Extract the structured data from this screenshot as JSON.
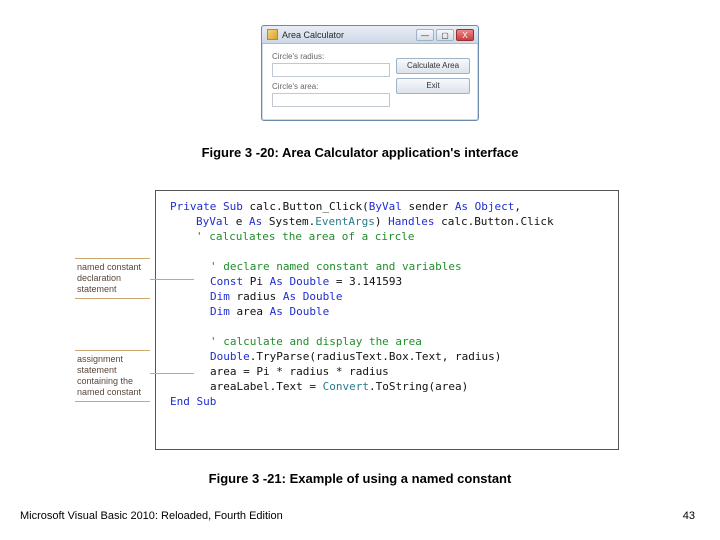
{
  "dialog": {
    "title": "Area Calculator",
    "label_radius": "Circle's radius:",
    "label_area": "Circle's area:",
    "btn_calc": "Calculate Area",
    "btn_exit": "Exit",
    "btn_min": "—",
    "btn_max": "▢",
    "btn_close": "X"
  },
  "caption1": "Figure 3 -20: Area Calculator application's interface",
  "caption2": "Figure 3 -21: Example of using a named constant",
  "anno1": "named constant declaration statement",
  "anno2": "assignment statement containing the named constant",
  "code": {
    "l1a": "Private Sub",
    "l1b": " calc.Button_Click(",
    "l1c": "ByVal",
    "l1d": " sender ",
    "l1e": "As Object",
    "l1f": ",",
    "l2a": "ByVal",
    "l2b": " e ",
    "l2c": "As",
    "l2d": " System.",
    "l2e": "EventArgs",
    "l2f": ") ",
    "l2g": "Handles",
    "l2h": " calc.Button.Click",
    "l3": "' calculates the area of a circle",
    "l5": "' declare named constant and variables",
    "l6a": "Const",
    "l6b": " Pi ",
    "l6c": "As Double",
    "l6d": " = 3.141593",
    "l7a": "Dim",
    "l7b": " radius ",
    "l7c": "As Double",
    "l8a": "Dim",
    "l8b": " area ",
    "l8c": "As Double",
    "l10": "' calculate and display the area",
    "l11a": "Double",
    "l11b": ".TryParse(radiusText.Box.Text, radius)",
    "l12": "area = Pi * radius * radius",
    "l13": "areaLabel.Text = ",
    "l13b": "Convert",
    "l13c": ".ToString(area)",
    "l14": "End Sub"
  },
  "footer": "Microsoft Visual Basic 2010: Reloaded, Fourth Edition",
  "page": "43"
}
